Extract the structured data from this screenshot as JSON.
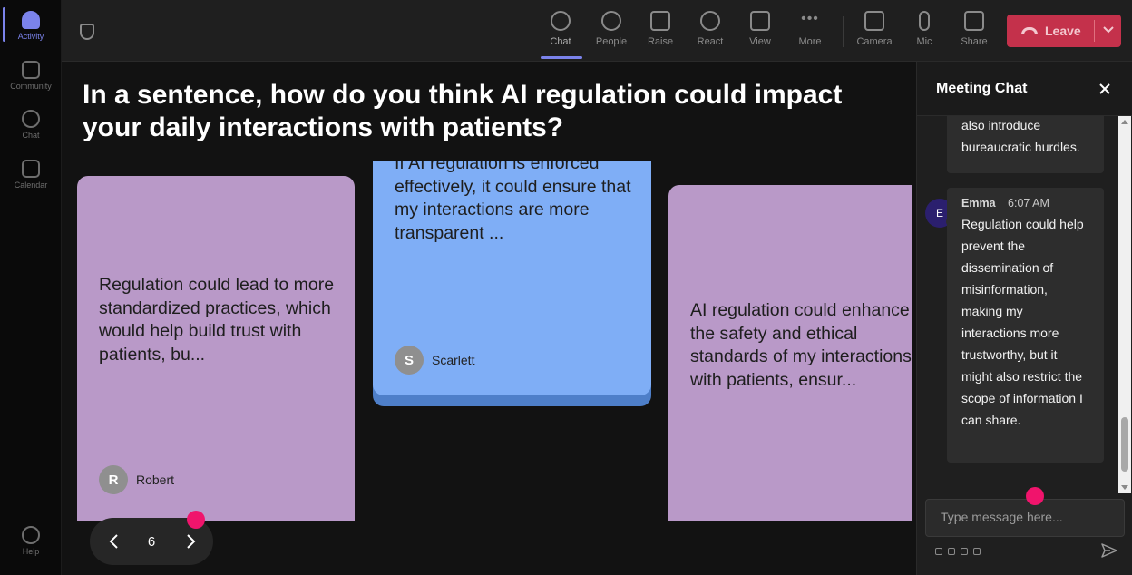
{
  "rail": {
    "items": [
      {
        "label": "Activity"
      },
      {
        "label": "Community"
      },
      {
        "label": "Chat"
      },
      {
        "label": "Calendar"
      }
    ],
    "help_label": "Help"
  },
  "toolbar": {
    "chat_label": "Chat",
    "people_label": "People",
    "raise_label": "Raise",
    "react_label": "React",
    "view_label": "View",
    "more_label": "More",
    "camera_label": "Camera",
    "mic_label": "Mic",
    "share_label": "Share",
    "leave_label": "Leave"
  },
  "stage": {
    "question": "In a sentence, how do you think AI regulation could impact your daily interactions with patients?",
    "cards": [
      {
        "text": "Regulation could lead to more standardized practices, which would help build trust with patients, bu...",
        "author": "Robert",
        "initial": "R"
      },
      {
        "text": "If AI regulation is enforced effectively, it could ensure that my interactions are more transparent ...",
        "author": "Scarlett",
        "initial": "S"
      },
      {
        "text": "AI regulation could enhance the safety and ethical standards of my interactions with patients, ensur..."
      }
    ],
    "pager": {
      "page": "6"
    }
  },
  "chat": {
    "title": "Meeting Chat",
    "messages": [
      {
        "text": "also introduce bureaucratic hurdles."
      },
      {
        "sender": "Emma",
        "initial": "E",
        "time": "6:07 AM",
        "text": "Regulation could help prevent the dissemination of misinformation, making my interactions more trustworthy, but it might also restrict the scope of information I can share."
      }
    ],
    "composer_placeholder": "Type message here..."
  },
  "colors": {
    "accent": "#7b83eb",
    "leave": "#c4314b",
    "card_purple": "#b999c8",
    "card_blue": "#7faef6",
    "notification_dot": "#f0146c"
  }
}
